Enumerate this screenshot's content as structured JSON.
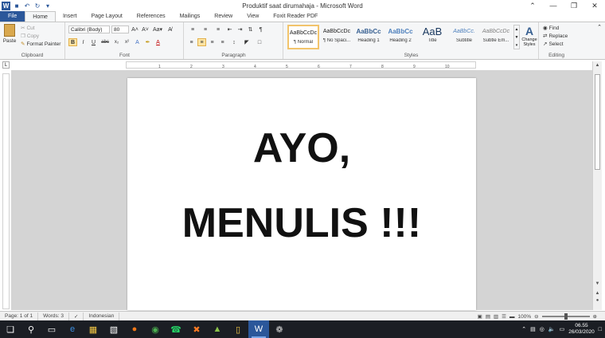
{
  "window": {
    "title": "Produktif saat dirumahaja  -  Microsoft Word",
    "controls": [
      "minimize",
      "maximize",
      "close"
    ]
  },
  "quick_access": [
    "word-logo",
    "save",
    "undo",
    "redo",
    "customize"
  ],
  "tabs": [
    {
      "label": "File",
      "active": false
    },
    {
      "label": "Home",
      "active": true
    },
    {
      "label": "Insert",
      "active": false
    },
    {
      "label": "Page Layout",
      "active": false
    },
    {
      "label": "References",
      "active": false
    },
    {
      "label": "Mailings",
      "active": false
    },
    {
      "label": "Review",
      "active": false
    },
    {
      "label": "View",
      "active": false
    },
    {
      "label": "Foxit Reader PDF",
      "active": false
    }
  ],
  "ribbon": {
    "clipboard": {
      "label": "Clipboard",
      "paste": "Paste",
      "cut": "Cut",
      "copy": "Copy",
      "format_painter": "Format Painter"
    },
    "font": {
      "label": "Font",
      "family": "Calibri (Body)",
      "size": "80",
      "grow": "A˄",
      "shrink": "A˅",
      "case": "Aa▾",
      "clear": "A̸"
    },
    "paragraph": {
      "label": "Paragraph"
    },
    "styles": {
      "label": "Styles",
      "items": [
        {
          "preview": "AaBbCcDc",
          "name": "¶ Normal",
          "selected": true
        },
        {
          "preview": "AaBbCcDc",
          "name": "¶ No Spaci...",
          "selected": false
        },
        {
          "preview": "AaBbCc",
          "name": "Heading 1",
          "selected": false
        },
        {
          "preview": "AaBbCc",
          "name": "Heading 2",
          "selected": false
        },
        {
          "preview": "AaB",
          "name": "Title",
          "selected": false
        },
        {
          "preview": "AaBbCc.",
          "name": "Subtitle",
          "selected": false
        },
        {
          "preview": "AaBbCcDc",
          "name": "Subtle Em...",
          "selected": false
        }
      ],
      "change_styles": "Change Styles"
    },
    "editing": {
      "label": "Editing",
      "find": "Find",
      "replace": "Replace",
      "select": "Select"
    }
  },
  "document": {
    "line1": "AYO,",
    "line2": "MENULIS !!!"
  },
  "status": {
    "page": "Page: 1 of 1",
    "words": "Words: 3",
    "language": "Indonesian",
    "zoom": "100%"
  },
  "taskbar": {
    "apps": [
      "windows-start",
      "search",
      "task-view",
      "edge",
      "file-explorer",
      "store",
      "firefox",
      "chrome",
      "whatsapp",
      "xampp",
      "photos",
      "folder",
      "word",
      "paint"
    ],
    "active_app": "word",
    "time": "06.55",
    "date": "26/03/2020"
  }
}
